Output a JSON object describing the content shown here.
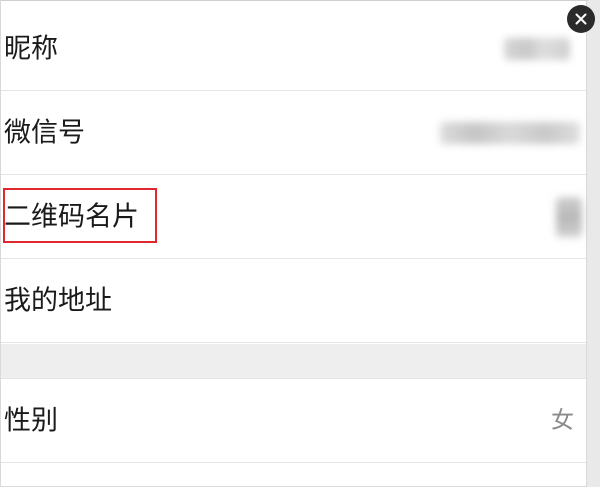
{
  "profile": {
    "rows": [
      {
        "label": "昵称"
      },
      {
        "label": "微信号"
      },
      {
        "label": "二维码名片"
      },
      {
        "label": "我的地址"
      }
    ],
    "gender": {
      "label": "性别",
      "value": "女"
    }
  },
  "icons": {
    "close": "close-icon"
  },
  "colors": {
    "highlight": "#e0282f",
    "close_bg": "#2b2b2b"
  }
}
